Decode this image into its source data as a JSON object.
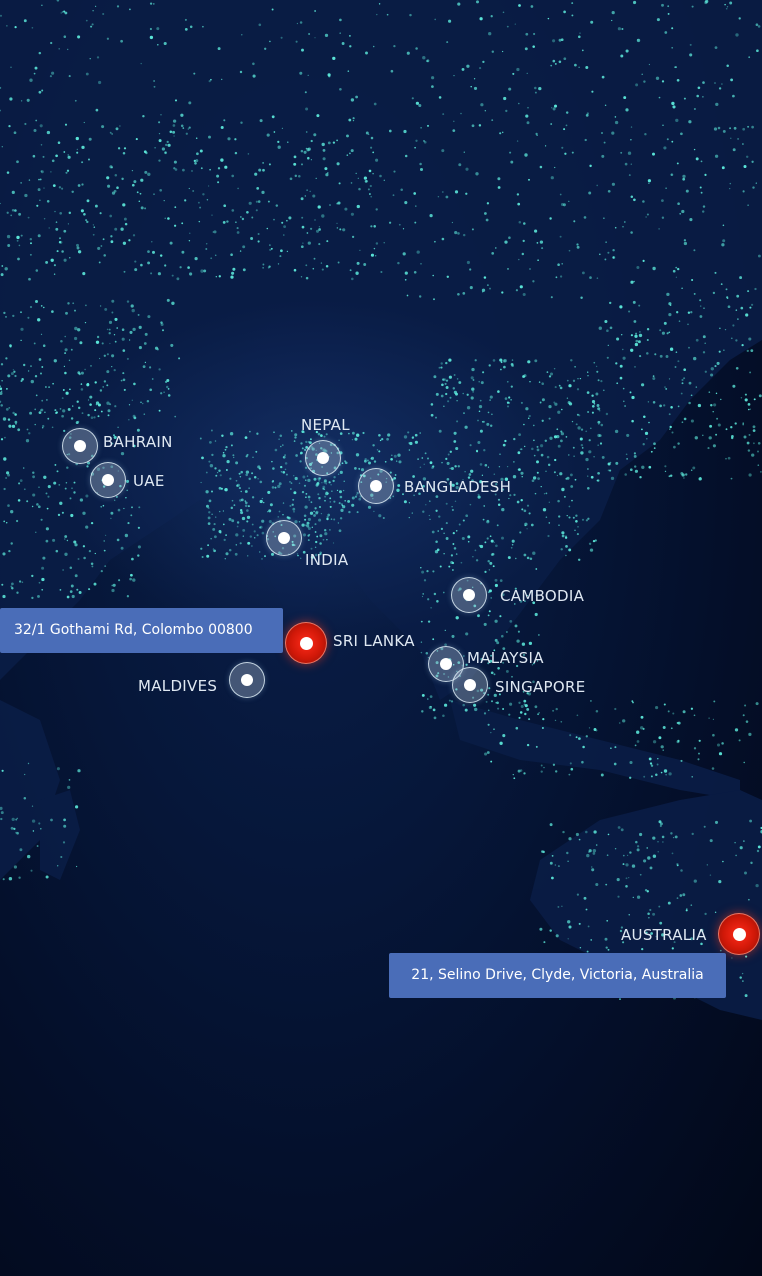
{
  "locations": {
    "bahrain": "BAHRAIN",
    "uae": "UAE",
    "nepal": "NEPAL",
    "bangladesh": "BANGLADESH",
    "india": "INDIA",
    "cambodia": "CAMBODIA",
    "sri_lanka": "SRI LANKA",
    "maldives": "MALDIVES",
    "malaysia": "MALAYSIA",
    "singapore": "SINGAPORE",
    "australia": "AUSTRALIA"
  },
  "offices": {
    "sri_lanka_address": "32/1 Gothami Rd, Colombo 00800",
    "australia_address": "21, Selino Drive, Clyde, Victoria, Australia"
  },
  "colors": {
    "background": "#020a22",
    "city_lights": "#5ff0e0",
    "hq_marker": "#e01e0f",
    "address_box": "#4a6db8"
  }
}
